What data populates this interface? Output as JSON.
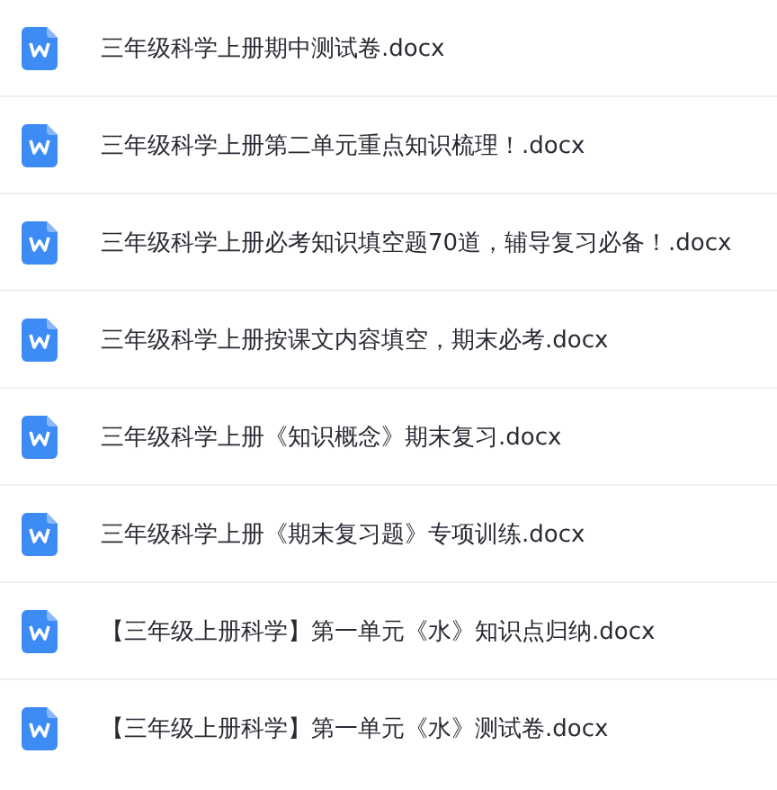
{
  "files": [
    {
      "name": "三年级科学上册期中测试卷.docx"
    },
    {
      "name": "三年级科学上册第二单元重点知识梳理！.docx"
    },
    {
      "name": "三年级科学上册必考知识填空题70道，辅导复习必备！.docx"
    },
    {
      "name": "三年级科学上册按课文内容填空，期末必考.docx"
    },
    {
      "name": "三年级科学上册《知识概念》期末复习.docx"
    },
    {
      "name": "三年级科学上册《期末复习题》专项训练.docx"
    },
    {
      "name": "【三年级上册科学】第一单元《水》知识点归纳.docx"
    },
    {
      "name": "【三年级上册科学】第一单元《水》测试卷.docx"
    }
  ]
}
